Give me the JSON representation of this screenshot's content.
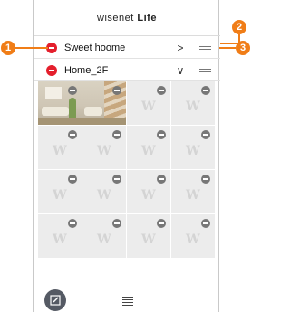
{
  "app": {
    "logo_text": "wisenet",
    "logo_suffix": "Life"
  },
  "groups": [
    {
      "name": "Sweet hoome",
      "chevron": ">"
    },
    {
      "name": "Home_2F",
      "chevron": "∨"
    }
  ],
  "tiles": [
    {
      "type": "camera"
    },
    {
      "type": "camera"
    },
    {
      "type": "empty",
      "mark": "W"
    },
    {
      "type": "empty",
      "mark": "W"
    },
    {
      "type": "empty",
      "mark": "W"
    },
    {
      "type": "empty",
      "mark": "W"
    },
    {
      "type": "empty",
      "mark": "W"
    },
    {
      "type": "empty",
      "mark": "W"
    },
    {
      "type": "empty",
      "mark": "W"
    },
    {
      "type": "empty",
      "mark": "W"
    },
    {
      "type": "empty",
      "mark": "W"
    },
    {
      "type": "empty",
      "mark": "W"
    },
    {
      "type": "empty",
      "mark": "W"
    },
    {
      "type": "empty",
      "mark": "W"
    },
    {
      "type": "empty",
      "mark": "W"
    },
    {
      "type": "empty",
      "mark": "W"
    }
  ],
  "callouts": [
    "1",
    "2",
    "3"
  ],
  "colors": {
    "delete": "#e41f2c",
    "callout": "#f07d17",
    "edit_button": "#555a64"
  },
  "icons": {
    "delete_group": "minus-circle-icon",
    "expand": "chevron-icon",
    "reorder": "drag-handle-icon",
    "edit": "edit-icon",
    "list": "list-icon"
  }
}
